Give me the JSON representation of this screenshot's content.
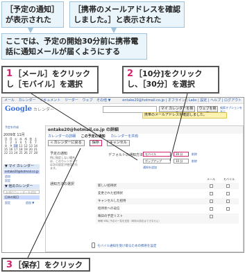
{
  "callouts": {
    "top_left": "［予定の通知］が表示された",
    "top_right": "［携帯のメールアドレスを確認しました。］と表示された",
    "intro": "ここでは、予定の開始30分前に携帯電話に通知メールが届くようにする"
  },
  "steps": [
    {
      "num": "1",
      "text": "［メール］をクリックし［モバイル］を選択"
    },
    {
      "num": "2",
      "text": "［10分]をクリックし、［30分］を選択"
    },
    {
      "num": "3",
      "text": "［保存］をクリック"
    }
  ],
  "colors": {
    "accent": "#d0246a",
    "callout_bg": "#eaf4fb",
    "callout_border": "#9fc3dd"
  },
  "screenshot": {
    "gbar_left": [
      "メール",
      "カレンダー",
      "ドキュメント",
      "リーダー",
      "ウェブ",
      "その他 ▼"
    ],
    "gbar_right": "entake20@hotmail.co.jp | オフライン | Labs | 設定 | ヘルプ | ログアウト",
    "logo": "Google",
    "logo_suffix": "カレンダー",
    "search_btn": "マイ カレンダーを検索",
    "search_opt": "検索オプションを表示",
    "search_web": "ウェブを検索",
    "notice": "携帯のメールアドレスを確認しました。",
    "create_link": "予定を作成",
    "minical_month": "2009年 11月",
    "minical_days": [
      "日",
      "月",
      "火",
      "水",
      "木",
      "金",
      "土",
      "1",
      "2",
      "3",
      "4",
      "5",
      "6",
      "7",
      "8",
      "9",
      "10",
      "11",
      "12",
      "13",
      "14",
      "15",
      "16",
      "17",
      "18",
      "19",
      "20",
      "21",
      "22",
      "23",
      "24",
      "25",
      "26",
      "27",
      "28"
    ],
    "my_cal_header": "▼ マイ カレンダー",
    "my_cal_item": "entake20@hotmail.co.jp",
    "my_cal_links": [
      "追加",
      "設定"
    ],
    "other_cal_header": "▼ 他のカレンダー",
    "other_cal_placeholder": "友達のカレンダーを追加",
    "other_cal_item": "日本の祝日",
    "other_cal_links": [
      "設定",
      "追加 ▼"
    ],
    "panel_title": "entake20@hotmail.co.jp の詳細",
    "panel_tabs": [
      "カレンダーの詳細",
      "この予定の通知",
      "カレンダーを共有"
    ],
    "back_link": "« カレンダーに戻る",
    "save_button": "保存",
    "cancel_button": "キャンセル",
    "event_reminder_label": "予定の通知",
    "event_reminder_sub": "特に指定しない場合は、このカレンダーでは次の設定が使用されます。",
    "default_method_label": "デフォルトの通知方法",
    "method1": "モバイル",
    "minutes1": "30 分",
    "method2": "ポップアップ",
    "minutes2": "10 分",
    "delete_link": "削除",
    "add_link": "通知を追加",
    "notification_label": "通知方法の選択",
    "col_mail": "メール",
    "col_mobile": "モバイル",
    "rows": [
      "新しい招待状",
      "変更された招待状",
      "キャンセルした招待",
      "招待状への返信",
      "毎日の予定リスト"
    ],
    "row_note": "毎朝 5時に予定の一覧を送信（時刻の設定はできません）",
    "mobile_setup": "モバイル通知を受け取るための携帯を設定"
  }
}
